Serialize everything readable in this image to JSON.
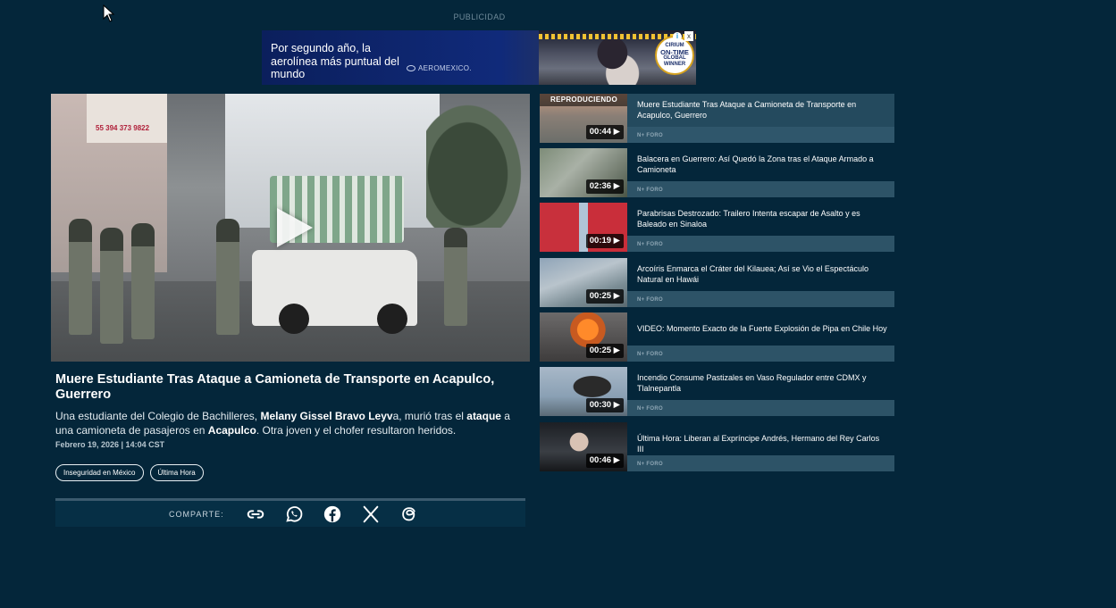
{
  "ad": {
    "label": "PUBLICIDAD",
    "text": "Por segundo año, la aerolínea más puntual del mundo",
    "brand": "AEROMEXICO.",
    "seal_top": "CIRIUM",
    "seal_main": "ON-TIME",
    "seal_bottom": "GLOBAL WINNER",
    "info": "i",
    "close": "x"
  },
  "player": {
    "sign_text": "55 394 373 9822",
    "play_icon": "play-icon"
  },
  "article": {
    "title": "Muere Estudiante Tras Ataque a Camioneta de Transporte en Acapulco, Guerrero",
    "summary_parts": {
      "p1": "Una estudiante del Colegio de Bachilleres, ",
      "b1": "Melany Gissel Bravo Leyv",
      "p2": "a, murió tras el ",
      "b2": "ataque",
      "p3": " a una camioneta de pasajeros en ",
      "b3": "Acapulco",
      "p4": ". Otra joven y el chofer resultaron heridos."
    },
    "date": "Febrero 19, 2026 | 14:04 CST",
    "tags": [
      "Inseguridad en México",
      "Última Hora"
    ],
    "share_label": "COMPARTE:",
    "share_icons": [
      "link-icon",
      "whatsapp-icon",
      "facebook-icon",
      "x-icon",
      "threads-icon"
    ]
  },
  "playlist": [
    {
      "title": "Muere Estudiante Tras Ataque a Camioneta de Transporte en Acapulco, Guerrero",
      "duration": "00:44 ▶",
      "source": "N+ FORO",
      "badge": "REPRODUCIENDO"
    },
    {
      "title": "Balacera en Guerrero: Así Quedó la Zona tras el Ataque Armado a Camioneta",
      "duration": "02:36 ▶",
      "source": "N+ FORO"
    },
    {
      "title": "Parabrisas Destrozado: Trailero Intenta escapar de Asalto y es Baleado en Sinaloa",
      "duration": "00:19 ▶",
      "source": "N+ FORO"
    },
    {
      "title": "Arcoíris Enmarca el Cráter del Kilauea; Así se Vio el Espectáculo Natural en Hawái",
      "duration": "00:25 ▶",
      "source": "N+ FORO"
    },
    {
      "title": "VIDEO: Momento Exacto de la Fuerte Explosión de Pipa en Chile Hoy",
      "duration": "00:25 ▶",
      "source": "N+ FORO"
    },
    {
      "title": "Incendio Consume Pastizales en Vaso Regulador entre CDMX y Tlalnepantla",
      "duration": "00:30 ▶",
      "source": "N+ FORO"
    },
    {
      "title": "Última Hora: Liberan al Expríncipe Andrés, Hermano del Rey Carlos III",
      "duration": "00:46 ▶",
      "source": "N+ FORO"
    }
  ]
}
